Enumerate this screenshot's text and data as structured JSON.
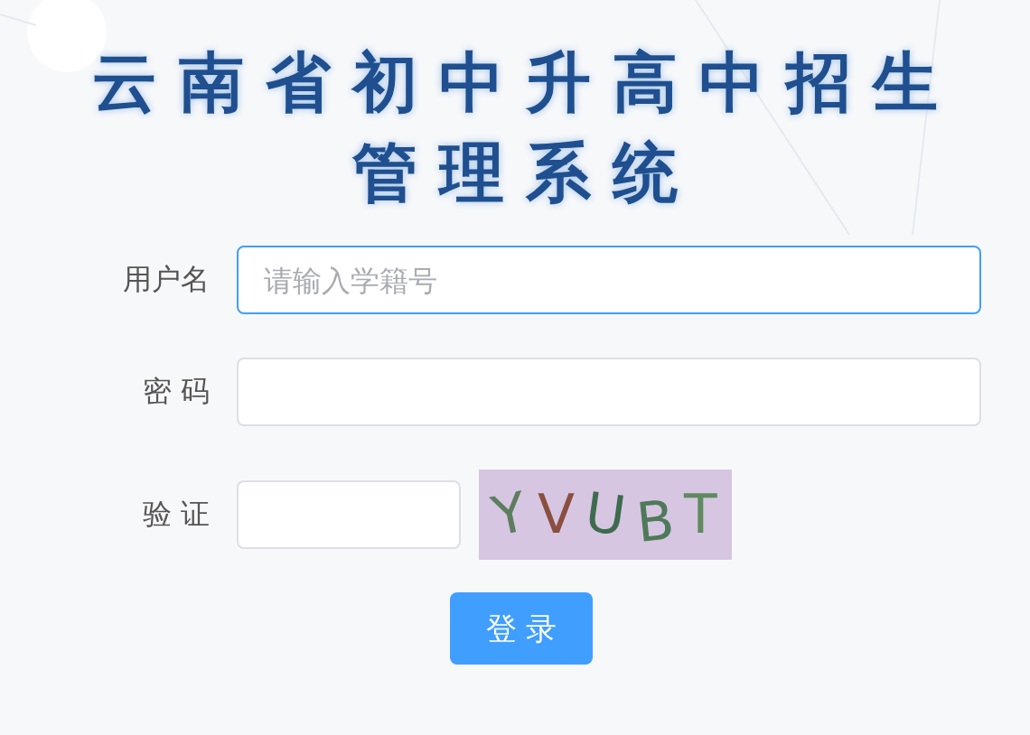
{
  "title": [
    "云南省初中升高中招生",
    "管理系统"
  ],
  "fields": [
    {
      "kind": "text",
      "label": "用户名",
      "placeholder": "请输入学籍号",
      "focused": true
    },
    {
      "kind": "password",
      "label": "密 码",
      "focused": false
    },
    {
      "kind": "captcha",
      "label": "验 证",
      "focused": false,
      "captcha_text": "YVUBT"
    }
  ],
  "login_button": "登 录"
}
